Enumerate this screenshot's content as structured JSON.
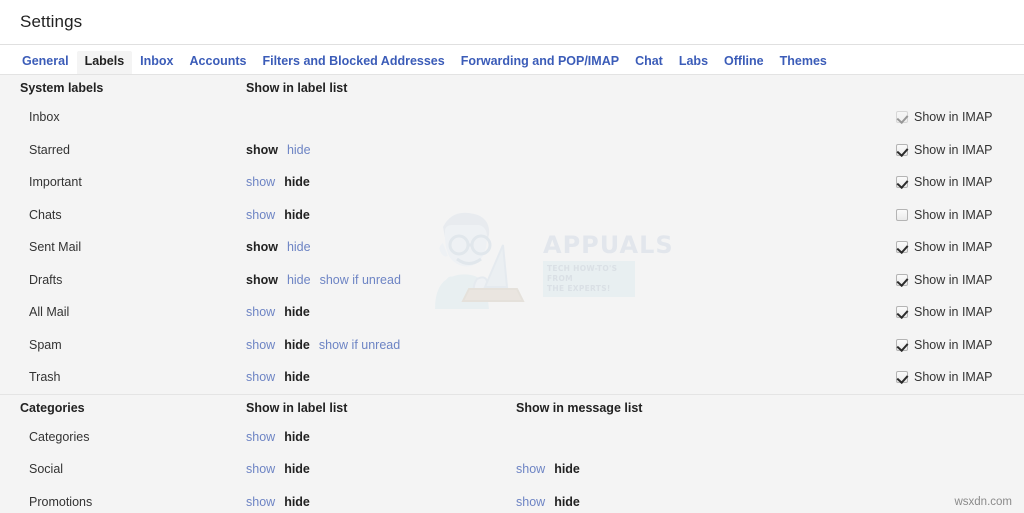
{
  "header": {
    "title": "Settings"
  },
  "tabs": [
    {
      "label": "General",
      "active": false
    },
    {
      "label": "Labels",
      "active": true
    },
    {
      "label": "Inbox",
      "active": false
    },
    {
      "label": "Accounts",
      "active": false
    },
    {
      "label": "Filters and Blocked Addresses",
      "active": false
    },
    {
      "label": "Forwarding and POP/IMAP",
      "active": false
    },
    {
      "label": "Chat",
      "active": false
    },
    {
      "label": "Labs",
      "active": false
    },
    {
      "label": "Offline",
      "active": false
    },
    {
      "label": "Themes",
      "active": false
    }
  ],
  "colors": {
    "link": "#6d84c4",
    "tab_link": "#3b5cb8",
    "text": "#333333",
    "page_bg": "#f4f4f4",
    "header_bg": "#ffffff"
  },
  "sections": [
    {
      "name": "system-labels",
      "heading": "System labels",
      "col_label_list": "Show in label list",
      "col_message_list": "",
      "rows": [
        {
          "name": "Inbox",
          "label_list": [],
          "message_list": [],
          "imap": {
            "label": "Show in IMAP",
            "checked": true,
            "faded": true
          }
        },
        {
          "name": "Starred",
          "label_list": [
            {
              "text": "show",
              "state": "on"
            },
            {
              "text": "hide",
              "state": "off"
            }
          ],
          "message_list": [],
          "imap": {
            "label": "Show in IMAP",
            "checked": true,
            "faded": false
          }
        },
        {
          "name": "Important",
          "label_list": [
            {
              "text": "show",
              "state": "off"
            },
            {
              "text": "hide",
              "state": "on"
            }
          ],
          "message_list": [],
          "imap": {
            "label": "Show in IMAP",
            "checked": true,
            "faded": false
          }
        },
        {
          "name": "Chats",
          "label_list": [
            {
              "text": "show",
              "state": "off"
            },
            {
              "text": "hide",
              "state": "on"
            }
          ],
          "message_list": [],
          "imap": {
            "label": "Show in IMAP",
            "checked": false,
            "faded": false
          }
        },
        {
          "name": "Sent Mail",
          "label_list": [
            {
              "text": "show",
              "state": "on"
            },
            {
              "text": "hide",
              "state": "off"
            }
          ],
          "message_list": [],
          "imap": {
            "label": "Show in IMAP",
            "checked": true,
            "faded": false
          }
        },
        {
          "name": "Drafts",
          "label_list": [
            {
              "text": "show",
              "state": "on"
            },
            {
              "text": "hide",
              "state": "off"
            },
            {
              "text": "show if unread",
              "state": "off"
            }
          ],
          "message_list": [],
          "imap": {
            "label": "Show in IMAP",
            "checked": true,
            "faded": false
          }
        },
        {
          "name": "All Mail",
          "label_list": [
            {
              "text": "show",
              "state": "off"
            },
            {
              "text": "hide",
              "state": "on"
            }
          ],
          "message_list": [],
          "imap": {
            "label": "Show in IMAP",
            "checked": true,
            "faded": false
          }
        },
        {
          "name": "Spam",
          "label_list": [
            {
              "text": "show",
              "state": "off"
            },
            {
              "text": "hide",
              "state": "on"
            },
            {
              "text": "show if unread",
              "state": "off"
            }
          ],
          "message_list": [],
          "imap": {
            "label": "Show in IMAP",
            "checked": true,
            "faded": false
          }
        },
        {
          "name": "Trash",
          "label_list": [
            {
              "text": "show",
              "state": "off"
            },
            {
              "text": "hide",
              "state": "on"
            }
          ],
          "message_list": [],
          "imap": {
            "label": "Show in IMAP",
            "checked": true,
            "faded": false
          }
        }
      ]
    },
    {
      "name": "categories",
      "heading": "Categories",
      "col_label_list": "Show in label list",
      "col_message_list": "Show in message list",
      "rows": [
        {
          "name": "Categories",
          "label_list": [
            {
              "text": "show",
              "state": "off"
            },
            {
              "text": "hide",
              "state": "on"
            }
          ],
          "message_list": [],
          "imap": null
        },
        {
          "name": "Social",
          "label_list": [
            {
              "text": "show",
              "state": "off"
            },
            {
              "text": "hide",
              "state": "on"
            }
          ],
          "message_list": [
            {
              "text": "show",
              "state": "off"
            },
            {
              "text": "hide",
              "state": "on"
            }
          ],
          "imap": null
        },
        {
          "name": "Promotions",
          "label_list": [
            {
              "text": "show",
              "state": "off"
            },
            {
              "text": "hide",
              "state": "on"
            }
          ],
          "message_list": [
            {
              "text": "show",
              "state": "off"
            },
            {
              "text": "hide",
              "state": "on"
            }
          ],
          "imap": null
        }
      ]
    }
  ],
  "watermark": {
    "brand": "APPUALS",
    "tagline_line1": "TECH HOW-TO'S FROM",
    "tagline_line2": "THE EXPERTS!"
  },
  "credit": "wsxdn.com"
}
